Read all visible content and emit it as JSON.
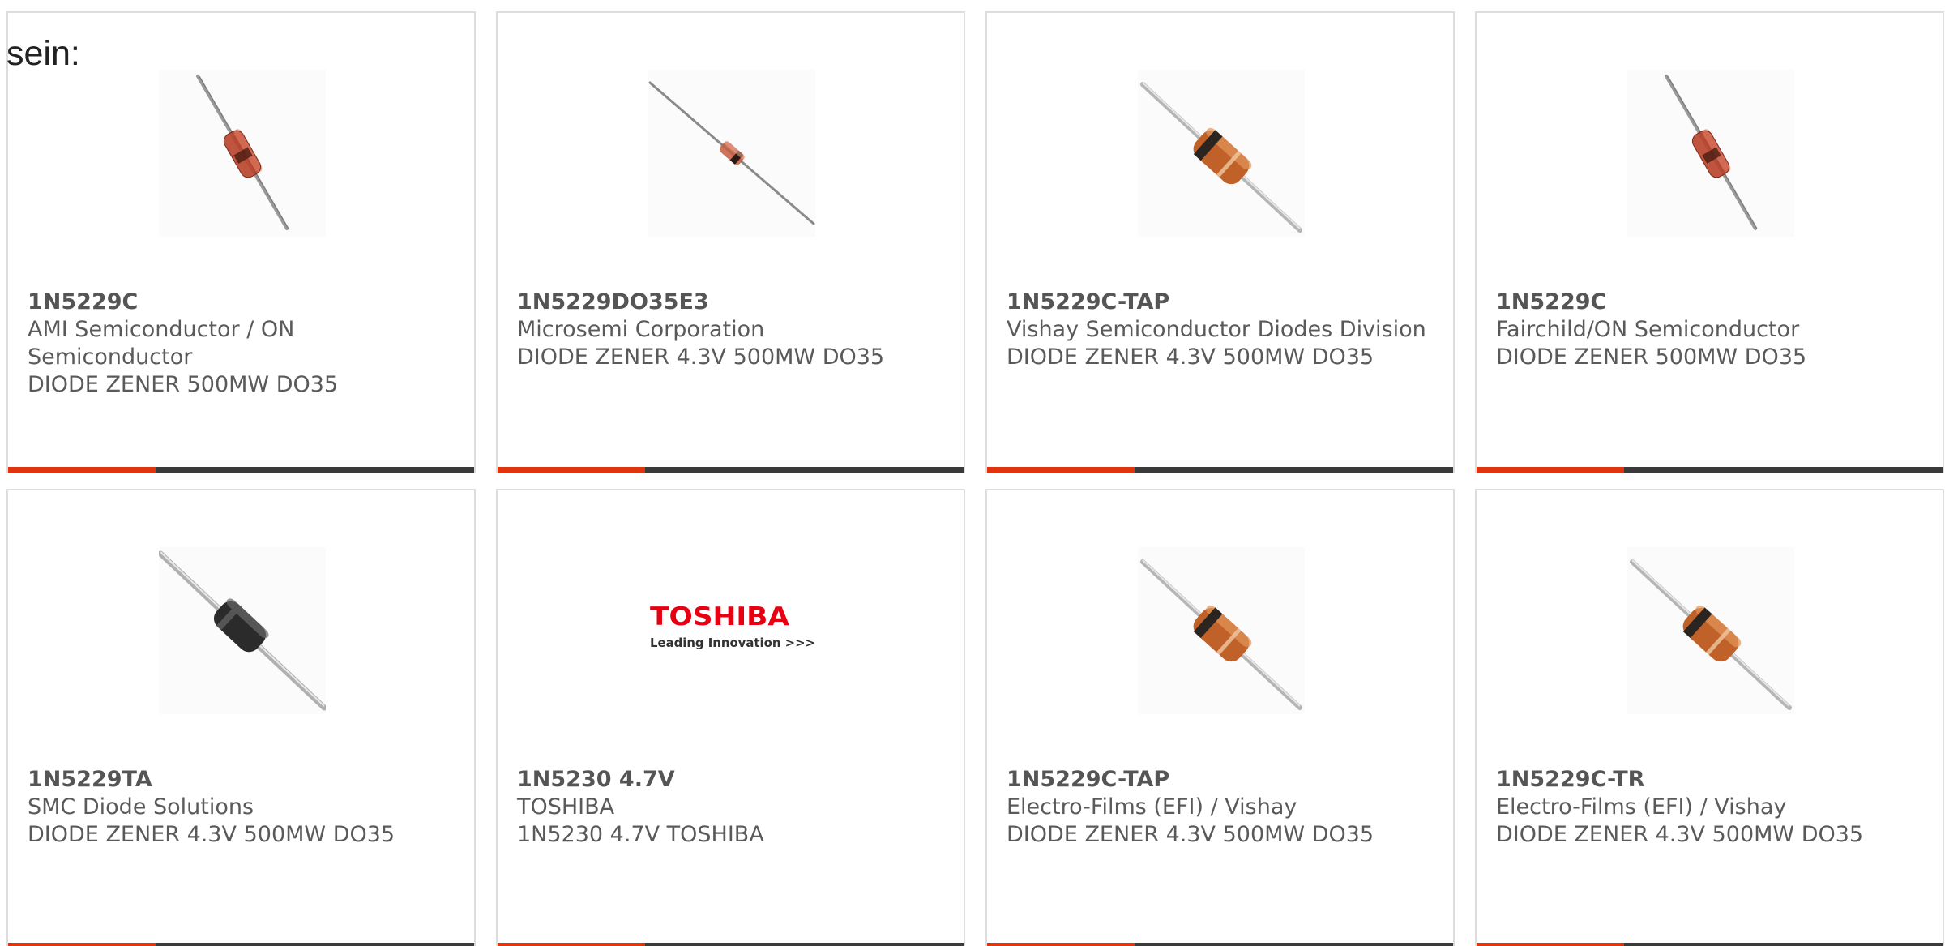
{
  "intro_text": "sein:",
  "colors": {
    "accent": "#e0340e",
    "bar": "#3a3a3a",
    "toshiba_red": "#e60012"
  },
  "products": [
    {
      "part": "1N5229C",
      "manufacturer": "AMI Semiconductor / ON Semiconductor",
      "description": "DIODE ZENER 500MW DO35",
      "image": "glass-diode-steep"
    },
    {
      "part": "1N5229DO35E3",
      "manufacturer": "Microsemi Corporation",
      "description": "DIODE ZENER 4.3V 500MW DO35",
      "image": "glass-diode-long-leads"
    },
    {
      "part": "1N5229C-TAP",
      "manufacturer": "Vishay Semiconductor Diodes Division",
      "description": "DIODE ZENER 4.3V 500MW DO35",
      "image": "orange-diode"
    },
    {
      "part": "1N5229C",
      "manufacturer": "Fairchild/ON Semiconductor",
      "description": "DIODE ZENER 500MW DO35",
      "image": "glass-diode-steep"
    },
    {
      "part": "1N5229TA",
      "manufacturer": "SMC Diode Solutions",
      "description": "DIODE ZENER 4.3V 500MW DO35",
      "image": "black-diode"
    },
    {
      "part": "1N5230 4.7V",
      "manufacturer": "TOSHIBA",
      "description": "1N5230 4.7V TOSHIBA",
      "image": "toshiba-logo",
      "logo_name": "TOSHIBA",
      "logo_tagline": "Leading Innovation >>>"
    },
    {
      "part": "1N5229C-TAP",
      "manufacturer": "Electro-Films (EFI) / Vishay",
      "description": "DIODE ZENER 4.3V 500MW DO35",
      "image": "orange-diode"
    },
    {
      "part": "1N5229C-TR",
      "manufacturer": "Electro-Films (EFI) / Vishay",
      "description": "DIODE ZENER 4.3V 500MW DO35",
      "image": "orange-diode"
    }
  ]
}
